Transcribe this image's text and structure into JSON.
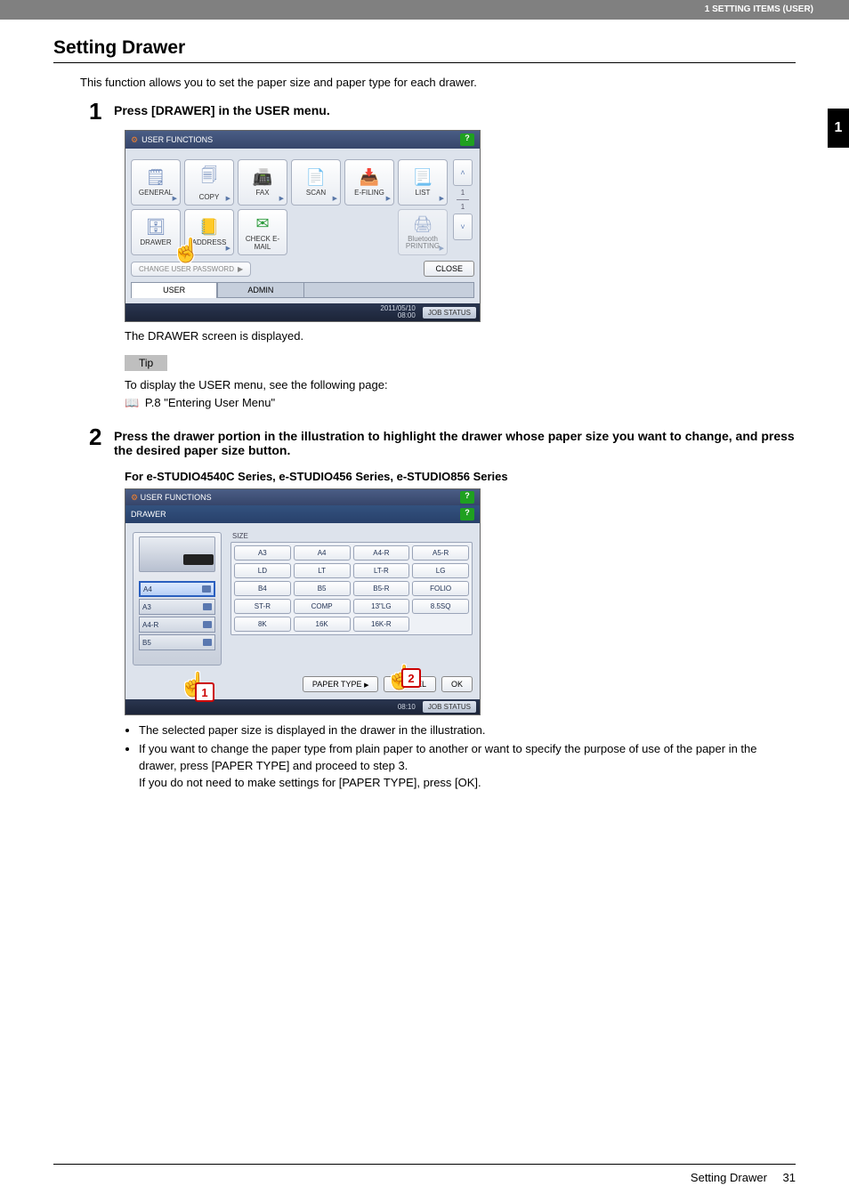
{
  "header": {
    "running": "1 SETTING ITEMS (USER)"
  },
  "sideTab": "1",
  "title": "Setting Drawer",
  "intro": "This function allows you to set the paper size and paper type for each drawer.",
  "step1": {
    "num": "1",
    "text": "Press [DRAWER] in the USER menu.",
    "caption": "The DRAWER screen is displayed."
  },
  "tip": {
    "label": "Tip",
    "line1": "To display the USER menu, see the following page:",
    "line2": "P.8 \"Entering User Menu\""
  },
  "step2": {
    "num": "2",
    "text": "Press the drawer portion in the illustration to highlight the drawer whose paper size you want to change, and press the desired paper size button.",
    "subhead": "For e-STUDIO4540C Series, e-STUDIO456 Series, e-STUDIO856 Series"
  },
  "ss1": {
    "title": "USER FUNCTIONS",
    "help": "?",
    "buttons_row1": [
      "GENERAL",
      "COPY",
      "FAX",
      "SCAN",
      "E-FILING",
      "LIST"
    ],
    "buttons_row2": [
      "DRAWER",
      "ADDRESS",
      "CHECK E-MAIL",
      "",
      "",
      "Bluetooth PRINTING"
    ],
    "chpw": "CHANGE USER PASSWORD",
    "close": "CLOSE",
    "tab_user": "USER",
    "tab_admin": "ADMIN",
    "page": "1",
    "pages": "1",
    "datetime": "2011/05/10\n08:00",
    "jobstatus": "JOB STATUS"
  },
  "ss2": {
    "title": "USER FUNCTIONS",
    "sub": "DRAWER",
    "help": "?",
    "size_label": "SIZE",
    "drawers": [
      "A4",
      "A3",
      "A4-R",
      "B5"
    ],
    "size_buttons": [
      [
        "A3",
        "A4",
        "A4-R",
        "A5-R"
      ],
      [
        "LD",
        "LT",
        "LT-R",
        "LG"
      ],
      [
        "B4",
        "B5",
        "B5-R",
        "FOLIO"
      ],
      [
        "ST-R",
        "COMP",
        "13\"LG",
        "8.5SQ"
      ],
      [
        "8K",
        "16K",
        "16K-R",
        ""
      ]
    ],
    "paper_type": "PAPER TYPE",
    "cancel": "CANCEL",
    "ok": "OK",
    "datetime": "08:10",
    "jobstatus": "JOB STATUS",
    "badge1": "1",
    "badge2": "2"
  },
  "bullets": [
    "The selected paper size is displayed in the drawer in the illustration.",
    "If you want to change the paper type from plain paper to another or want to specify the purpose of use of the paper in the drawer, press [PAPER TYPE] and proceed to step 3.\nIf you do not need to make settings for [PAPER TYPE], press [OK]."
  ],
  "footer": {
    "label": "Setting Drawer",
    "page": "31"
  }
}
